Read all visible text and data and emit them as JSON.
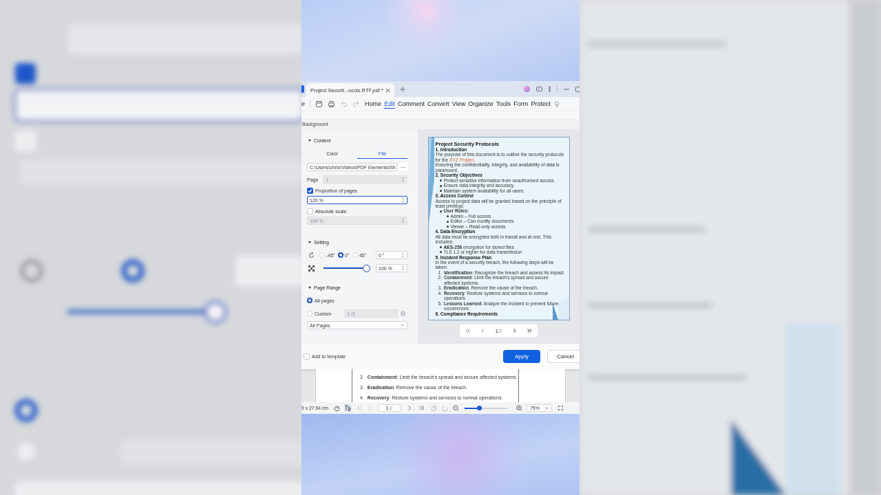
{
  "tab_bar": {
    "tabs": [
      {
        "label": "Project Securit...ocols.RTF.pdf *",
        "selected": true
      }
    ]
  },
  "toolbar": {
    "left_label": "e",
    "menu": [
      {
        "label": "Home",
        "selected": false
      },
      {
        "label": "Edit",
        "selected": true
      },
      {
        "label": "Comment",
        "selected": false
      },
      {
        "label": "Convert",
        "selected": false
      },
      {
        "label": "View",
        "selected": false
      },
      {
        "label": "Organize",
        "selected": false
      },
      {
        "label": "Tools",
        "selected": false
      },
      {
        "label": "Form",
        "selected": false
      },
      {
        "label": "Protect",
        "selected": false
      }
    ]
  },
  "dialog": {
    "title": "Background",
    "content": {
      "heading": "Content",
      "expanded": true,
      "tabs": [
        {
          "label": "Color",
          "selected": false
        },
        {
          "label": "File",
          "selected": true
        }
      ],
      "file_path": "C:\\Users\\chris\\Videos\\PDF Elements\\Sh",
      "browse_button": "···",
      "page_label": "Page",
      "page_value": "1",
      "page_disabled": true,
      "proportion": {
        "label": "Proportion of pages",
        "checked": true,
        "value": "120 %",
        "focused": true
      },
      "absolute": {
        "label": "Absolute scale",
        "checked": false,
        "value": "100 %",
        "focused": false
      }
    },
    "setting": {
      "heading": "Setting",
      "expanded": true,
      "angles": [
        {
          "label": "-45°",
          "selected": false
        },
        {
          "label": "0°",
          "selected": true
        },
        {
          "label": "45°",
          "selected": false
        }
      ],
      "angle_value": "0 °",
      "scale": {
        "level": 1,
        "value": "100 %"
      }
    },
    "page_range": {
      "heading": "Page Range",
      "expanded": true,
      "options": [
        {
          "label": "All pages",
          "selected": true
        },
        {
          "label": "Custom",
          "selected": false
        }
      ],
      "custom_value": "1 /2",
      "subset": "All Pages"
    },
    "preview": {
      "document": [
        {
          "kind": "title",
          "text": "Project Security Protocols"
        },
        {
          "kind": "heading",
          "text": "1. Introduction"
        },
        {
          "kind": "para",
          "text": "The purpose of this document is to outline the security protocols for the ",
          "link": "XYZ Project."
        },
        {
          "kind": "para",
          "text": "Ensuring the confidentiality, integrity, and availability of data is paramount."
        },
        {
          "kind": "heading",
          "text": "2. Security Objectives"
        },
        {
          "kind": "bullet",
          "text": "Protect sensitive information from unauthorized access."
        },
        {
          "kind": "bullet",
          "text": "Ensure data integrity and accuracy."
        },
        {
          "kind": "bullet",
          "text": "Maintain system availability for all users."
        },
        {
          "kind": "heading",
          "text": "3. Access Control"
        },
        {
          "kind": "para",
          "text": "Access to project data will be granted based on the principle of least privilege."
        },
        {
          "kind": "bullet",
          "text": "**User Roles:**"
        },
        {
          "kind": "sub",
          "text": "Admin –  Full access"
        },
        {
          "kind": "sub",
          "text": "Editor –  Can modify documents"
        },
        {
          "kind": "sub",
          "text": "Viewer –  Read-only access"
        },
        {
          "kind": "heading",
          "text": "4. Data Encryption"
        },
        {
          "kind": "para",
          "text": "All data must be encrypted both in transit and at rest. This includes:"
        },
        {
          "kind": "bullet",
          "text": "**AES-256** encryption for stored files"
        },
        {
          "kind": "bullet",
          "text": "TLS 1.2 or higher for data transmission"
        },
        {
          "kind": "heading",
          "text": "5. Incident Response Plan"
        },
        {
          "kind": "para",
          "text": "In the event of a security breach, the following steps will be taken:"
        },
        {
          "kind": "numbered",
          "number": "1.",
          "text": "**Identification**: Recognize the breach and assess its impact."
        },
        {
          "kind": "numbered",
          "number": "2.",
          "text": "**Containment**: Limit the breach's spread and secure affected systems."
        },
        {
          "kind": "numbered",
          "number": "3.",
          "text": "**Eradication**: Remove the cause of the breach."
        },
        {
          "kind": "numbered",
          "number": "4.",
          "text": "**Recovery**: Restore systems and services to normal operations."
        },
        {
          "kind": "numbered",
          "number": "5.",
          "text": "**Lessons Learned**: Analyze the incident to prevent future occurrences."
        },
        {
          "kind": "heading",
          "text": "6. Compliance Requirements"
        }
      ],
      "pager": {
        "page": "1",
        "total": "/2"
      }
    },
    "footer": {
      "add_to_template": {
        "label": "Add to template",
        "checked": false
      },
      "buttons": [
        {
          "label": "Apply",
          "kind": "primary"
        },
        {
          "label": "Cancel",
          "kind": "secondary"
        }
      ]
    }
  },
  "document_behind": [
    {
      "number": "2.",
      "text": "**Containment**: Limit the breach's spread and secure affected systems."
    },
    {
      "number": "3.",
      "text": "**Eradication**: Remove the cause of the breach."
    },
    {
      "number": "4.",
      "text": "**Recovery**: Restore systems and services to normal operations."
    }
  ],
  "status_bar": {
    "page_size": "9 x 27.94 cm",
    "page": "1",
    "total": "/2",
    "zoom": {
      "level": 0.33,
      "value": "75%"
    }
  }
}
